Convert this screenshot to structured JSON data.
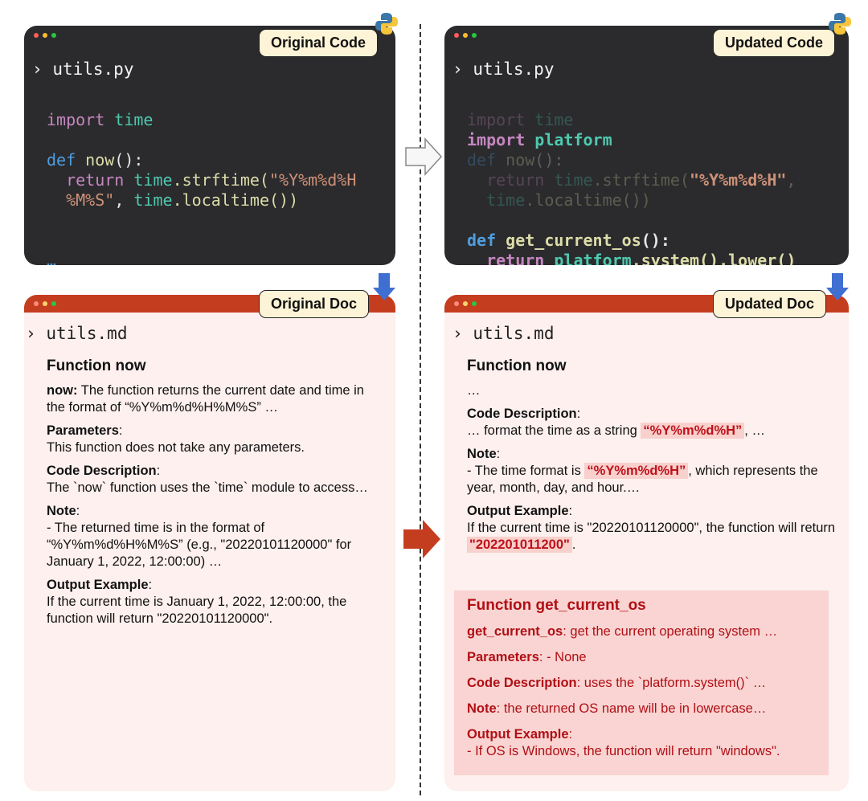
{
  "original_code": {
    "badge": "Original Code",
    "filename": "utils.py",
    "line1_kw": "import",
    "line1_mod": "time",
    "line2_kw": "def",
    "line2_fn": "now",
    "line2_rest": "():",
    "line3_kw": "return",
    "line3_mod": "time",
    "line3_fn": ".strftime(",
    "line3_str": "\"%Y%m%d%H",
    "line4_str": "%M%S\"",
    "line4_comma": ", ",
    "line4_mod": "time",
    "line4_fn": ".localtime())",
    "ellipsis": "…"
  },
  "updated_code": {
    "badge": "Updated Code",
    "filename": "utils.py",
    "l1_kw": "import",
    "l1_mod": "time",
    "l2_kw": "import",
    "l2_mod": "platform",
    "l3_kw": "def",
    "l3_fn": "now",
    "l3_rest": "():",
    "l4_kw": "return",
    "l4_mod": "time",
    "l4_fn": ".strftime(",
    "l4_str": "\"%Y%m%d%H\"",
    "l4_comma": ",",
    "l5_mod": "time",
    "l5_fn": ".localtime())",
    "l6_kw": "def",
    "l6_fn": "get_current_os",
    "l6_rest": "():",
    "l7_kw": "return",
    "l7_mod": "platform",
    "l7_fn": ".system().lower()"
  },
  "original_doc": {
    "badge": "Original Doc",
    "filename": "utils.md",
    "title": "Function now",
    "p1_b": "now:",
    "p1": " The function returns the current date and time in the format of “%Y%m%d%H%M%S” …",
    "params_h": "Parameters",
    "colon": ":",
    "params": "This function does not take any parameters.",
    "desc_h": "Code Description",
    "desc": "The `now` function uses the `time` module to access…",
    "note_h": "Note",
    "note": "- The returned time is in the format of “%Y%m%d%H%M%S” (e.g., \"20220101120000\" for January 1, 2022, 12:00:00) …",
    "out_h": "Output Example",
    "out": "If the current time is January 1, 2022, 12:00:00, the function will return \"20220101120000\"."
  },
  "updated_doc": {
    "badge": "Updated Doc",
    "filename": "utils.md",
    "title": "Function now",
    "ellipsis": "…",
    "desc_h": "Code Description",
    "colon": ":",
    "desc_pre": "… format the time as a string ",
    "desc_hl": "“%Y%m%d%H”",
    "desc_post": ", …",
    "note_h": "Note",
    "note_pre": "- The time format is ",
    "note_hl": "“%Y%m%d%H”",
    "note_post": ", which represents the year, month, day, and hour.…",
    "out_h": "Output Example",
    "out_pre": "If the current time is \"20220101120000\", the function will return ",
    "out_hl": "\"202201011200\"",
    "out_post": ".",
    "new_title": "Function get_current_os",
    "n1_b": "get_current_os",
    "n1": ": get the current operating system …",
    "n2_b": "Parameters",
    "n2": ": - None",
    "n3_b": "Code Description",
    "n3": ": uses the `platform.system()` …",
    "n4_b": "Note",
    "n4": ": the returned OS name will be in lowercase…",
    "n5_b": "Output Example",
    "n5": ":",
    "n6": "- If OS is Windows, the function will return \"windows\"."
  },
  "colors": {
    "code_bg": "#2b2b2d",
    "doc_bar": "#c53d1f",
    "doc_bg": "#fdf0ee",
    "accent_red": "#b10f15",
    "arrow_blue": "#3f6fd1"
  }
}
